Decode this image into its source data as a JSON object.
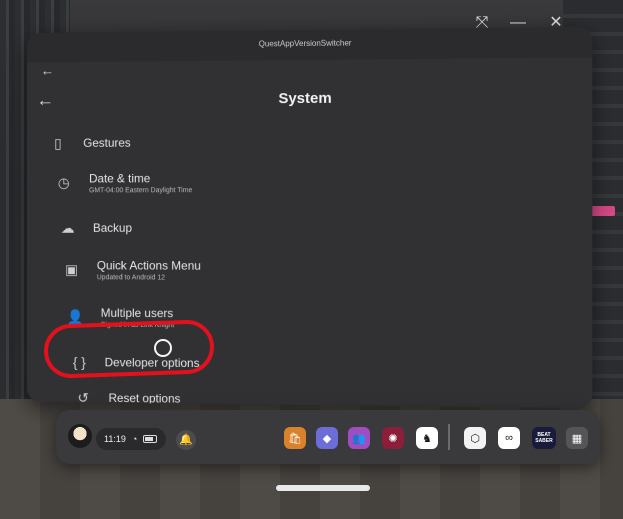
{
  "window": {
    "app_title": "QuestAppVersionSwitcher",
    "controls": [
      "⤧",
      "—",
      "✕"
    ]
  },
  "page": {
    "title": "System"
  },
  "settings": {
    "items": [
      {
        "title": "Gestures",
        "subtitle": "",
        "icon": "phone-icon"
      },
      {
        "title": "Date & time",
        "subtitle": "GMT-04:00 Eastern Daylight Time",
        "icon": "clock-icon"
      },
      {
        "title": "Backup",
        "subtitle": "",
        "icon": "cloud-upload-icon"
      },
      {
        "title": "Quick Actions Menu",
        "subtitle": "Updated to Android 12",
        "icon": "system-update-icon"
      },
      {
        "title": "Multiple users",
        "subtitle": "Signed in as Link Knight",
        "icon": "person-icon"
      },
      {
        "title": "Developer options",
        "subtitle": "",
        "icon": "braces-icon"
      },
      {
        "title": "Reset options",
        "subtitle": "",
        "icon": "history-icon"
      }
    ]
  },
  "taskbar": {
    "time": "11:19",
    "apps": [
      {
        "name": "store-app-icon",
        "glyph": "🛍",
        "color": "#d9822b"
      },
      {
        "name": "explore-app-icon",
        "glyph": "◆",
        "color": "#6d6dd8"
      },
      {
        "name": "people-app-icon",
        "glyph": "👥",
        "color": "#a24cc2"
      },
      {
        "name": "game-app-icon",
        "glyph": "✺",
        "color": "#8b1f3a"
      },
      {
        "name": "sidequest-app-icon",
        "glyph": "♞",
        "color": "#ffffff"
      },
      {
        "name": "vd-app-icon",
        "glyph": "⬡",
        "color": "#f2f2f2"
      },
      {
        "name": "meta-app-icon",
        "glyph": "∞",
        "color": "#ffffff"
      },
      {
        "name": "beatsaber-app-icon",
        "glyph": "BEAT SABER",
        "color": "#1a1a3a"
      },
      {
        "name": "app-library-icon",
        "glyph": "▦",
        "color": "#555559"
      }
    ]
  }
}
